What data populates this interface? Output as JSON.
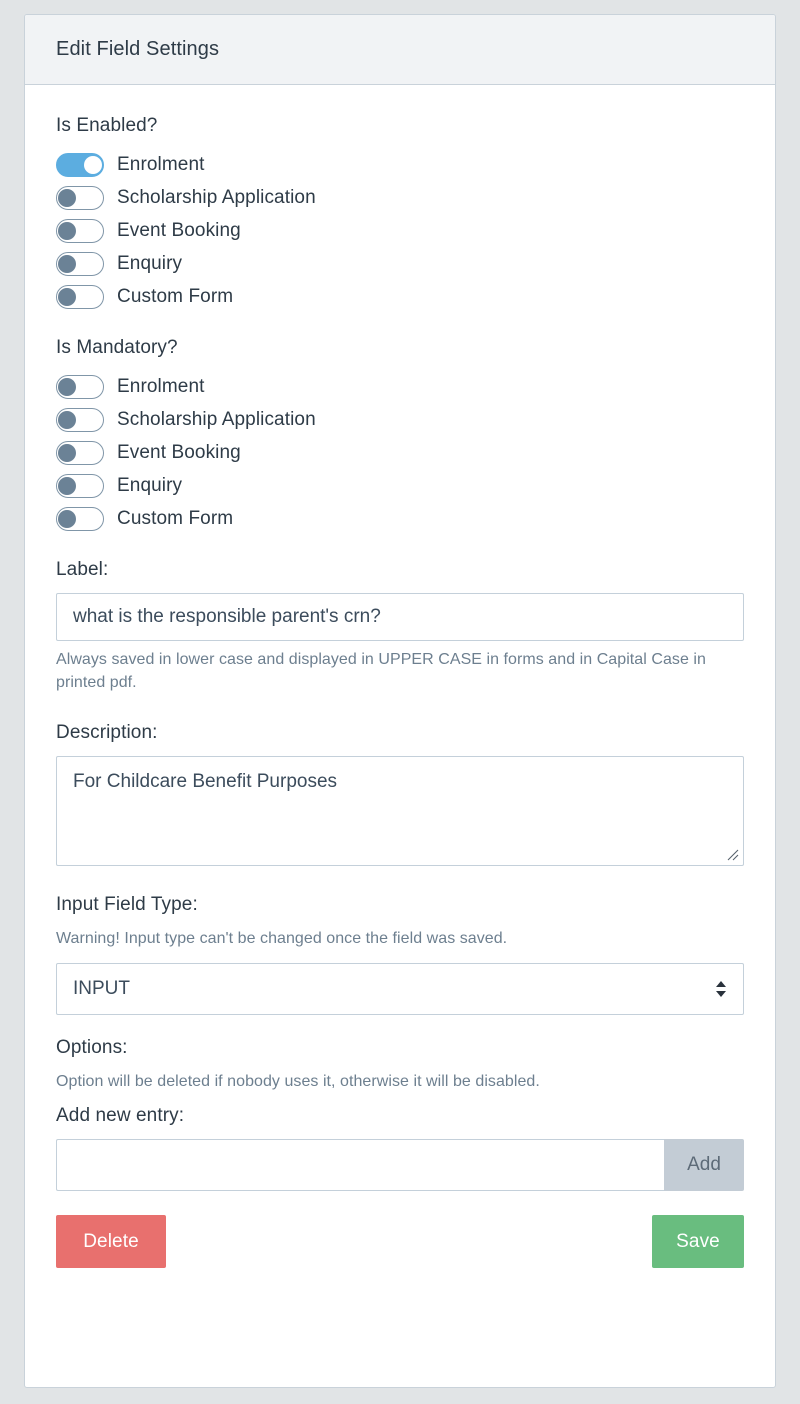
{
  "window": {
    "title": "Edit Field Settings"
  },
  "sections": {
    "is_enabled": {
      "heading": "Is Enabled?",
      "toggles": [
        {
          "label": "Enrolment",
          "on": true
        },
        {
          "label": "Scholarship Application",
          "on": false
        },
        {
          "label": "Event Booking",
          "on": false
        },
        {
          "label": "Enquiry",
          "on": false
        },
        {
          "label": "Custom Form",
          "on": false
        }
      ]
    },
    "is_mandatory": {
      "heading": "Is Mandatory?",
      "toggles": [
        {
          "label": "Enrolment",
          "on": false
        },
        {
          "label": "Scholarship Application",
          "on": false
        },
        {
          "label": "Event Booking",
          "on": false
        },
        {
          "label": "Enquiry",
          "on": false
        },
        {
          "label": "Custom Form",
          "on": false
        }
      ]
    },
    "label_field": {
      "heading": "Label:",
      "value": "what is the responsible parent's crn?",
      "placeholder": "",
      "help": "Always saved in lower case and displayed in UPPER CASE in forms and in Capital Case in printed pdf."
    },
    "description_field": {
      "heading": "Description:",
      "value": "For Childcare Benefit Purposes",
      "placeholder": ""
    },
    "input_field_type": {
      "heading": "Input Field Type:",
      "warning": "Warning! Input type can't be changed once the field was saved.",
      "selected": "INPUT",
      "options": [
        "INPUT"
      ]
    },
    "options_section": {
      "heading": "Options:",
      "help": "Option will be deleted if nobody uses it, otherwise it will be disabled.",
      "add_new_label": "Add new entry:",
      "new_entry_value": "",
      "new_entry_placeholder": "",
      "add_button_label": "Add"
    }
  },
  "footer": {
    "delete_label": "Delete",
    "save_label": "Save"
  },
  "colors": {
    "toggle_on": "#5cade0",
    "toggle_off_knob": "#6b8296",
    "delete": "#e8706e",
    "save": "#69bd7f",
    "addon": "#c3ccd5",
    "header_bg": "#f1f3f5",
    "page_bg": "#e1e4e6",
    "border": "#c9d2da",
    "text": "#2e3b47",
    "muted_text": "#6d7f8f"
  }
}
